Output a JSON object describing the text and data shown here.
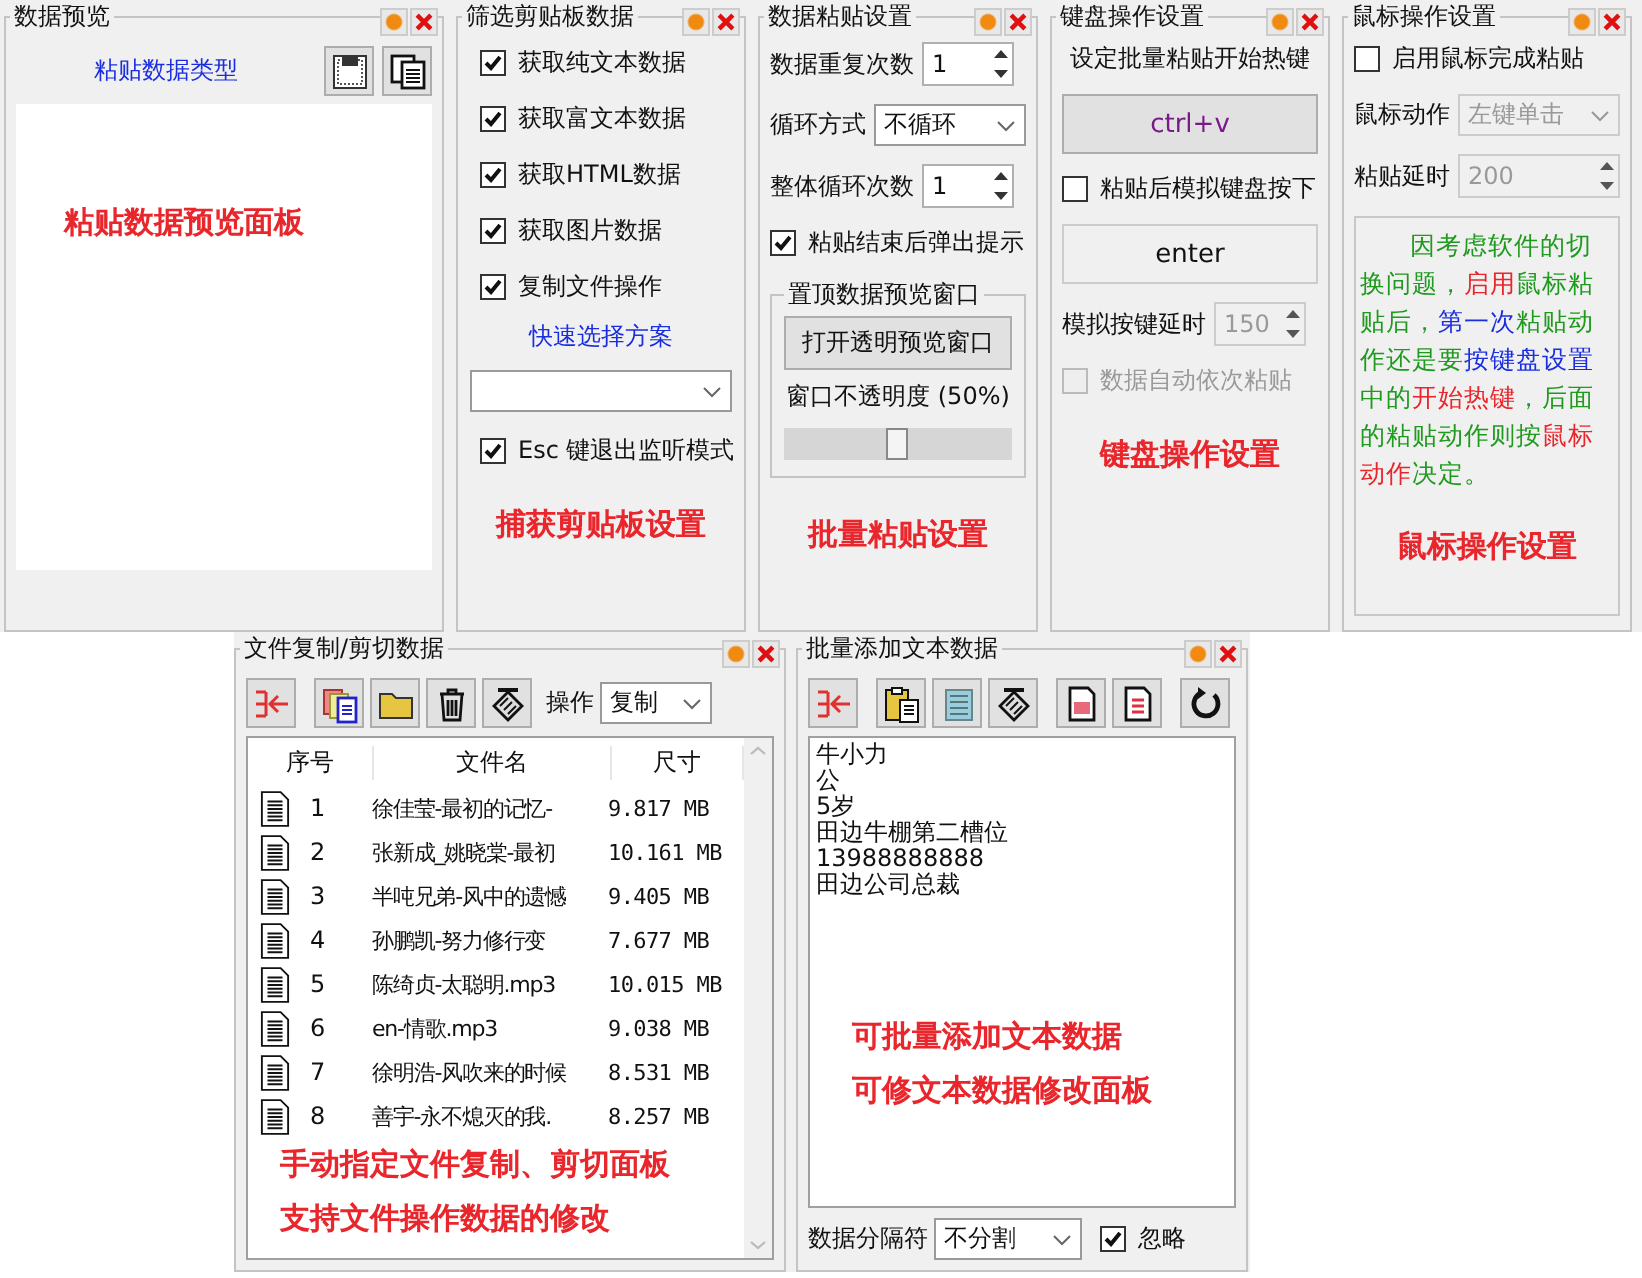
{
  "preview": {
    "title": "数据预览",
    "type_label": "粘贴数据类型",
    "annotation": "粘贴数据预览面板"
  },
  "filter": {
    "title": "筛选剪贴板数据",
    "options": [
      {
        "label": "获取纯文本数据",
        "checked": true
      },
      {
        "label": "获取富文本数据",
        "checked": true
      },
      {
        "label": "获取HTML数据",
        "checked": true
      },
      {
        "label": "获取图片数据",
        "checked": true
      },
      {
        "label": "复制文件操作",
        "checked": true
      }
    ],
    "scheme_link": "快速选择方案",
    "esc": {
      "label": "Esc 键退出监听模式",
      "checked": true
    },
    "annotation": "捕获剪贴板设置"
  },
  "paste": {
    "title": "数据粘贴设置",
    "fields": [
      {
        "kind": "spin",
        "label": "数据重复次数",
        "value": "1"
      },
      {
        "kind": "select",
        "label": "循环方式",
        "value": "不循环"
      },
      {
        "kind": "spin",
        "label": "整体循环次数",
        "value": "1"
      }
    ],
    "popup": {
      "label": "粘贴结束后弹出提示",
      "checked": true
    },
    "topmost": {
      "title": "置顶数据预览窗口",
      "button": "打开透明预览窗口",
      "opacity_label": "窗口不透明度 (50%)",
      "level": 0.5
    },
    "annotation": "批量粘贴设置"
  },
  "keyboard": {
    "title": "键盘操作设置",
    "hotkey_label": "设定批量粘贴开始热键",
    "hotkey": "ctrl+v",
    "simulate": {
      "label": "粘贴后模拟键盘按下",
      "checked": false
    },
    "key": {
      "label": "enter",
      "disabled": true
    },
    "delay": {
      "label": "模拟按键延时",
      "value": "150",
      "disabled": true
    },
    "auto": {
      "label": "数据自动依次粘贴",
      "checked": false,
      "disabled": true
    },
    "annotation": "键盘操作设置"
  },
  "mouse": {
    "title": "鼠标操作设置",
    "enable": {
      "label": "启用鼠标完成粘贴",
      "checked": false
    },
    "action": {
      "label": "鼠标动作",
      "value": "左键单击",
      "disabled": true
    },
    "delay": {
      "label": "粘贴延时",
      "value": "200",
      "disabled": true
    },
    "note": [
      {
        "text": "因考虑软件的切换问题，",
        "color": "#1f9a1f"
      },
      {
        "text": "启用",
        "color": "#e8262b"
      },
      {
        "text": "鼠标粘贴后，",
        "color": "#1f9a1f"
      },
      {
        "text": "第一次",
        "color": "#1a2ee0"
      },
      {
        "text": "粘贴动作还是要",
        "color": "#1f9a1f"
      },
      {
        "text": "按键盘设置",
        "color": "#1a2ee0"
      },
      {
        "text": "中的",
        "color": "#1f9a1f"
      },
      {
        "text": "开始热键",
        "color": "#e8262b"
      },
      {
        "text": "，后面的粘贴动作则按",
        "color": "#1f9a1f"
      },
      {
        "text": "鼠标动作",
        "color": "#e8262b"
      },
      {
        "text": "决定。",
        "color": "#1f9a1f"
      }
    ],
    "annotation": "鼠标操作设置"
  },
  "files": {
    "title": "文件复制/剪切数据",
    "op_label": "操作",
    "op_value": "复制",
    "columns": [
      "序号",
      "文件名",
      "尺寸"
    ],
    "rows": [
      {
        "index": "1",
        "name": "徐佳莹-最初的记忆-",
        "size": "9.817 MB"
      },
      {
        "index": "2",
        "name": "张新成_姚晓棠-最初",
        "size": "10.161 MB"
      },
      {
        "index": "3",
        "name": "半吨兄弟-风中的遗憾",
        "size": "9.405 MB"
      },
      {
        "index": "4",
        "name": "孙鹏凯-努力修行变",
        "size": "7.677 MB"
      },
      {
        "index": "5",
        "name": "陈绮贞-太聪明.mp3",
        "size": "10.015 MB"
      },
      {
        "index": "6",
        "name": "en-情歌.mp3",
        "size": "9.038 MB"
      },
      {
        "index": "7",
        "name": "徐明浩-风吹来的时候",
        "size": "8.531 MB"
      },
      {
        "index": "8",
        "name": "善宇-永不熄灭的我.",
        "size": "8.257 MB"
      }
    ],
    "annotation": [
      "手动指定文件复制、剪切面板",
      "支持文件操作数据的修改"
    ]
  },
  "text": {
    "title": "批量添加文本数据",
    "lines": [
      "牛小力",
      "公",
      "5岁",
      "田边牛棚第二槽位",
      "13988888888",
      "田边公司总裁"
    ],
    "annotation": [
      "可批量添加文本数据",
      "可修文本数据修改面板"
    ],
    "separator_label": "数据分隔符",
    "separator": "不分割",
    "ignore": {
      "label": "忽略",
      "checked": true
    }
  }
}
